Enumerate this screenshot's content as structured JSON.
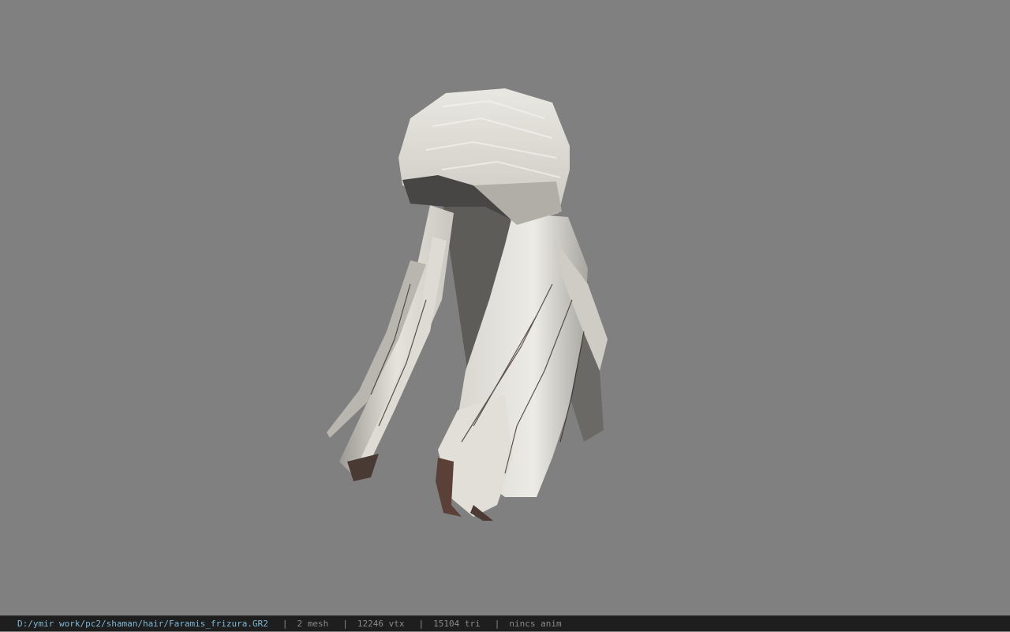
{
  "viewer": {
    "background_color": "#808080",
    "model_icon": "hair-mesh-model"
  },
  "status": {
    "file_path": "D:/ymir work/pc2/shaman/hair/Faramis_frizura.GR2",
    "separator": "|",
    "mesh_count": "2 mesh",
    "vertex_count": "12246 vtx",
    "triangle_count": "15104 tri",
    "animation": "nincs anim",
    "path_color": "#7fb8d8",
    "text_color": "#8a8a8a"
  }
}
